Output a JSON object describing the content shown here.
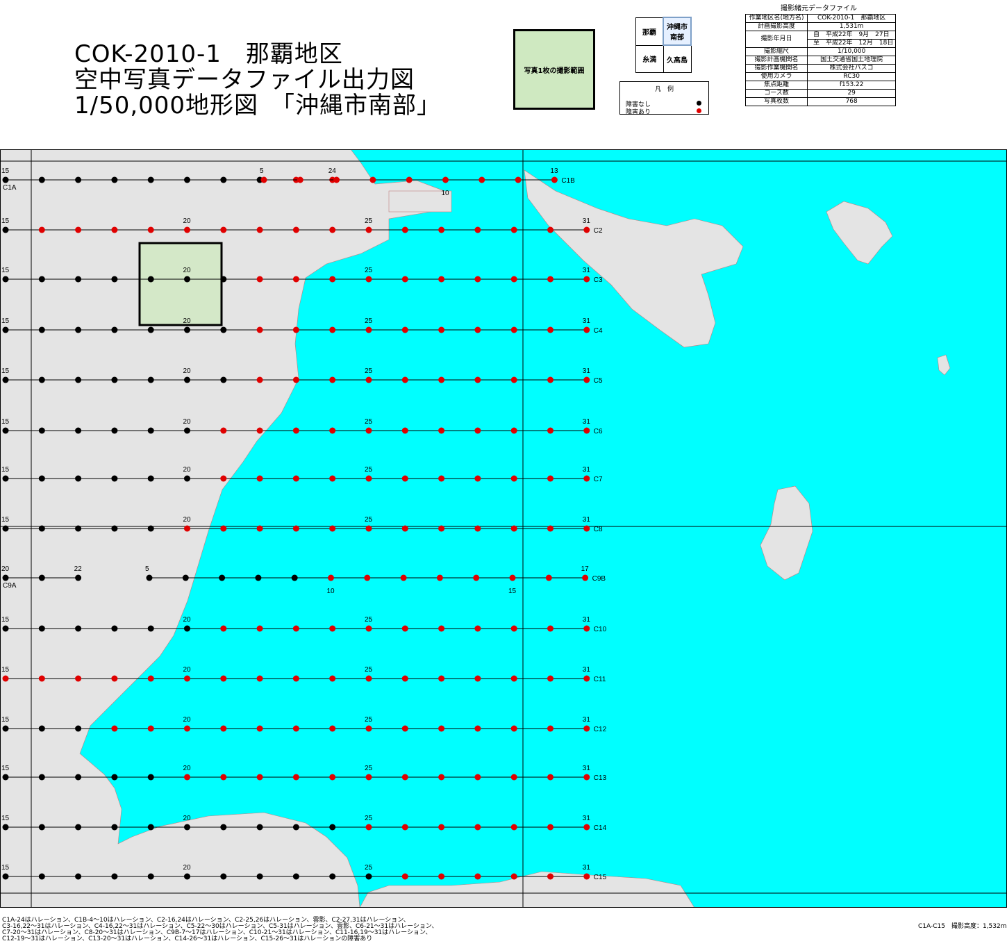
{
  "title": {
    "line1": "COK-2010-1　那覇地区",
    "line2": "空中写真データファイル出力図",
    "line3": "1/50,000地形図　「沖縄市南部」"
  },
  "photo_range_label": "写真1枚の撮影範囲",
  "sheet_index": {
    "top_left": "那覇",
    "top_right": "沖縄市南部",
    "bottom_left": "糸満",
    "bottom_right": "久高島"
  },
  "legend": {
    "title": "凡　例",
    "items": [
      {
        "label": "障害なし",
        "color": "#000000"
      },
      {
        "label": "障害あり",
        "color": "#e00000"
      }
    ]
  },
  "specs": {
    "title": "撮影緒元データファイル",
    "rows": [
      {
        "key": "作業地区名(地方名)",
        "value": "COK-2010-1　那覇地区"
      },
      {
        "key": "計画撮影高度",
        "value": "1,531m"
      },
      {
        "key": "撮影年月日",
        "value": "自　平成22年　9月　27日"
      },
      {
        "key": "",
        "value": "至　平成22年　12月　18日"
      },
      {
        "key": "撮影縮尺",
        "value": "1/10,000"
      },
      {
        "key": "撮影計画機関名",
        "value": "国土交通省国土地理院"
      },
      {
        "key": "撮影作業機関名",
        "value": "株式会社パスコ"
      },
      {
        "key": "使用カメラ",
        "value": "RC30"
      },
      {
        "key": "焦点距離",
        "value": "f153.22"
      },
      {
        "key": "コース数",
        "value": "29"
      },
      {
        "key": "写真枚数",
        "value": "768"
      }
    ]
  },
  "map": {
    "colors": {
      "sea": "#00ffff",
      "land": "#e6e6e6",
      "obstacle": "#e00000",
      "clear": "#000000"
    },
    "courses": [
      {
        "name": "C1A",
        "start_label": "15",
        "end_label": "24",
        "n": 10,
        "red_from": 9
      },
      {
        "name": "C1B",
        "start_label": "5",
        "mid_label": "10",
        "end_label": "13",
        "n": 9,
        "red_from": 0
      },
      {
        "name": "C2",
        "start_label": "15",
        "mid_labels": [
          "20",
          "25"
        ],
        "end_label": "31",
        "n": 17,
        "red_from": 1
      },
      {
        "name": "C3",
        "start_label": "15",
        "mid_labels": [
          "20",
          "25"
        ],
        "end_label": "31",
        "n": 17,
        "red_from": 7
      },
      {
        "name": "C4",
        "start_label": "15",
        "mid_labels": [
          "20",
          "25"
        ],
        "end_label": "31",
        "n": 17,
        "red_from": 7
      },
      {
        "name": "C5",
        "start_label": "15",
        "mid_labels": [
          "20",
          "25"
        ],
        "end_label": "31",
        "n": 17,
        "red_from": 7
      },
      {
        "name": "C6",
        "start_label": "15",
        "mid_labels": [
          "20",
          "25"
        ],
        "end_label": "31",
        "n": 17,
        "red_from": 6
      },
      {
        "name": "C7",
        "start_label": "15",
        "mid_labels": [
          "20",
          "25"
        ],
        "end_label": "31",
        "n": 17,
        "red_from": 6
      },
      {
        "name": "C8",
        "start_label": "15",
        "mid_labels": [
          "20",
          "25"
        ],
        "end_label": "31",
        "n": 17,
        "red_from": 5
      },
      {
        "name": "C9A",
        "start_label": "20",
        "end_label": "22",
        "n": 3,
        "red_from": 99
      },
      {
        "name": "C9B",
        "start_label": "5",
        "mid_label": "10",
        "end_label": "17",
        "extra": "15",
        "n": 13,
        "red_from": 5
      },
      {
        "name": "C10",
        "start_label": "15",
        "mid_labels": [
          "20",
          "25"
        ],
        "end_label": "31",
        "n": 17,
        "red_from": 6
      },
      {
        "name": "C11",
        "start_label": "15",
        "mid_labels": [
          "20",
          "25"
        ],
        "end_label": "31",
        "n": 17,
        "red_from": 0
      },
      {
        "name": "C12",
        "start_label": "15",
        "mid_labels": [
          "20",
          "25"
        ],
        "end_label": "31",
        "n": 17,
        "red_from": 3
      },
      {
        "name": "C13",
        "start_label": "15",
        "mid_labels": [
          "20",
          "25"
        ],
        "end_label": "31",
        "n": 17,
        "red_from": 5
      },
      {
        "name": "C14",
        "start_label": "15",
        "mid_labels": [
          "20",
          "25"
        ],
        "end_label": "31",
        "n": 17,
        "red_from": 10
      },
      {
        "name": "C15",
        "start_label": "15",
        "mid_labels": [
          "20",
          "25"
        ],
        "end_label": "31",
        "n": 17,
        "red_from": 11
      }
    ]
  },
  "notes": [
    "C1A-24はハレーション、C1B-4～10はハレーション、C2-16,24はハレーション、C2-25,26はハレーション、雲影、C2-27,31はハレーション、",
    "C3-16,22～31はハレーション、C4-16,22～31はハレーション、C5-22～30はハレーション、C5-31はハレーション、雲影、C6-21～31はハレーション、",
    "C7-20～31はハレーション、C8-20～31はハレーション、C9B-7～17はハレーション、C10-21～31はハレーション、C11-16,19～31はハレーション、",
    "C12-19～31はハレーション、C13-20～31はハレーション、C14-26～31はハレーション、C15-26～31はハレーションの障害あり"
  ],
  "footer_right": "C1A-C15　撮影高度：1,532m"
}
